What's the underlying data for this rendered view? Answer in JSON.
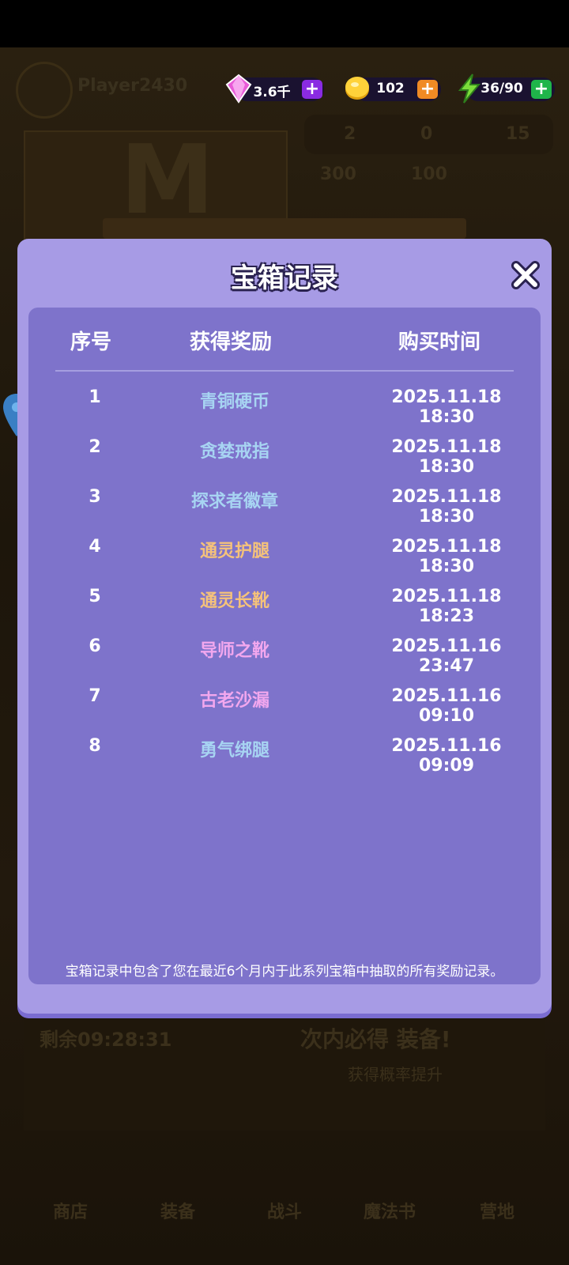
{
  "background": {
    "player_name": "Player2430",
    "poster_letter": "M",
    "stats": [
      "2",
      "0",
      "15"
    ],
    "stat_values": [
      "300",
      "100"
    ],
    "timer": "剩余09:28:31",
    "promo": "次内必得 装备!",
    "promo_sub": "获得概率提升",
    "nav": [
      "商店",
      "装备",
      "战斗",
      "魔法书",
      "营地"
    ]
  },
  "currency": {
    "gems": "3.6千",
    "coins": "102",
    "energy": "36/90",
    "gems_plus_color": "#8a2be2",
    "coins_plus_color": "#f08a24",
    "energy_plus_color": "#1fb54a"
  },
  "modal": {
    "title": "宝箱记录",
    "headers": {
      "index": "序号",
      "reward": "获得奖励",
      "time": "购买时间"
    },
    "rows": [
      {
        "index": "1",
        "reward": "青铜硬币",
        "time": "2025.11.18 18:30",
        "color": "#a7d4f2"
      },
      {
        "index": "2",
        "reward": "贪婪戒指",
        "time": "2025.11.18 18:30",
        "color": "#a7d4f2"
      },
      {
        "index": "3",
        "reward": "探求者徽章",
        "time": "2025.11.18 18:30",
        "color": "#a7d4f2"
      },
      {
        "index": "4",
        "reward": "通灵护腿",
        "time": "2025.11.18 18:30",
        "color": "#f5c27a"
      },
      {
        "index": "5",
        "reward": "通灵长靴",
        "time": "2025.11.18 18:23",
        "color": "#f5c27a"
      },
      {
        "index": "6",
        "reward": "导师之靴",
        "time": "2025.11.16 23:47",
        "color": "#f2a7ee"
      },
      {
        "index": "7",
        "reward": "古老沙漏",
        "time": "2025.11.16 09:10",
        "color": "#f2a7ee"
      },
      {
        "index": "8",
        "reward": "勇气绑腿",
        "time": "2025.11.16 09:09",
        "color": "#a7d4f2"
      }
    ],
    "footer": "宝箱记录中包含了您在最近6个月内于此系列宝箱中抽取的所有奖励记录。"
  }
}
